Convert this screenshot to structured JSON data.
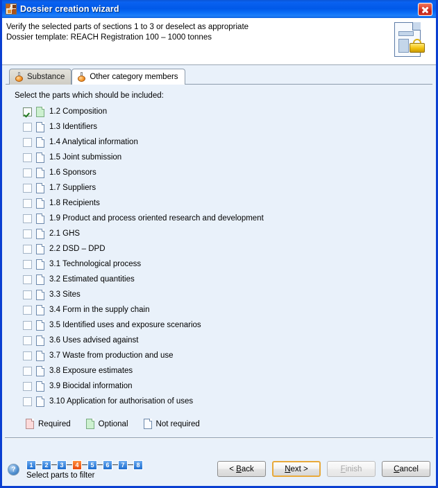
{
  "window": {
    "title": "Dossier creation wizard",
    "title_icon": "app-mosaic-icon",
    "close_label": "×"
  },
  "header": {
    "line1": "Verify the selected parts of sections 1 to 3 or deselect as appropriate",
    "line2": "Dossier template: REACH Registration 100 – 1000 tonnes",
    "icon": "locked-document-icon"
  },
  "tabs": [
    {
      "label": "Substance",
      "icon": "flask-icon",
      "active": false
    },
    {
      "label": "Other category members",
      "icon": "flask-icon",
      "active": true
    }
  ],
  "main": {
    "prompt": "Select the parts which should be included:",
    "parts": [
      {
        "label": "1.2 Composition",
        "checked": true,
        "state": "optional"
      },
      {
        "label": "1.3 Identifiers",
        "checked": false,
        "state": "not"
      },
      {
        "label": "1.4 Analytical information",
        "checked": false,
        "state": "not"
      },
      {
        "label": "1.5 Joint submission",
        "checked": false,
        "state": "not"
      },
      {
        "label": "1.6 Sponsors",
        "checked": false,
        "state": "not"
      },
      {
        "label": "1.7 Suppliers",
        "checked": false,
        "state": "not"
      },
      {
        "label": "1.8 Recipients",
        "checked": false,
        "state": "not"
      },
      {
        "label": "1.9 Product and process oriented research and development",
        "checked": false,
        "state": "not"
      },
      {
        "label": "2.1 GHS",
        "checked": false,
        "state": "not"
      },
      {
        "label": "2.2 DSD – DPD",
        "checked": false,
        "state": "not"
      },
      {
        "label": "3.1 Technological process",
        "checked": false,
        "state": "not"
      },
      {
        "label": "3.2 Estimated quantities",
        "checked": false,
        "state": "not"
      },
      {
        "label": "3.3 Sites",
        "checked": false,
        "state": "not"
      },
      {
        "label": "3.4 Form in the supply chain",
        "checked": false,
        "state": "not"
      },
      {
        "label": "3.5 Identified uses and exposure scenarios",
        "checked": false,
        "state": "not"
      },
      {
        "label": "3.6 Uses advised against",
        "checked": false,
        "state": "not"
      },
      {
        "label": "3.7 Waste from production and use",
        "checked": false,
        "state": "not"
      },
      {
        "label": "3.8 Exposure estimates",
        "checked": false,
        "state": "not"
      },
      {
        "label": "3.9 Biocidal information",
        "checked": false,
        "state": "not"
      },
      {
        "label": "3.10 Application for authorisation of uses",
        "checked": false,
        "state": "not"
      }
    ]
  },
  "legend": [
    {
      "label": "Required",
      "state": "required",
      "color": "#fcdada"
    },
    {
      "label": "Optional",
      "state": "optional",
      "color": "#ccf0cf"
    },
    {
      "label": "Not required",
      "state": "not",
      "color": "#fbfdff"
    }
  ],
  "footer": {
    "help_icon": "help-question-icon",
    "steps": [
      "1",
      "2",
      "3",
      "4",
      "5",
      "6",
      "7",
      "8"
    ],
    "current_step": "4",
    "steps_caption": "Select parts to filter",
    "buttons": [
      {
        "name": "back",
        "pre": "< ",
        "mn": "B",
        "post": "ack",
        "style": "normal",
        "enabled": true
      },
      {
        "name": "next",
        "pre": "",
        "mn": "N",
        "post": "ext >",
        "style": "default",
        "enabled": true
      },
      {
        "name": "finish",
        "pre": "",
        "mn": "F",
        "post": "inish",
        "style": "disabled",
        "enabled": false
      },
      {
        "name": "cancel",
        "pre": "",
        "mn": "C",
        "post": "ancel",
        "style": "normal",
        "enabled": true
      }
    ]
  },
  "colors": {
    "titlebar": "#0a62f0",
    "body_bg": "#e9f1fa",
    "accent_current_step": "#e8490c",
    "step_blue": "#1f6fd0",
    "default_button_border": "#e8a93a",
    "close_red": "#c3211b"
  }
}
